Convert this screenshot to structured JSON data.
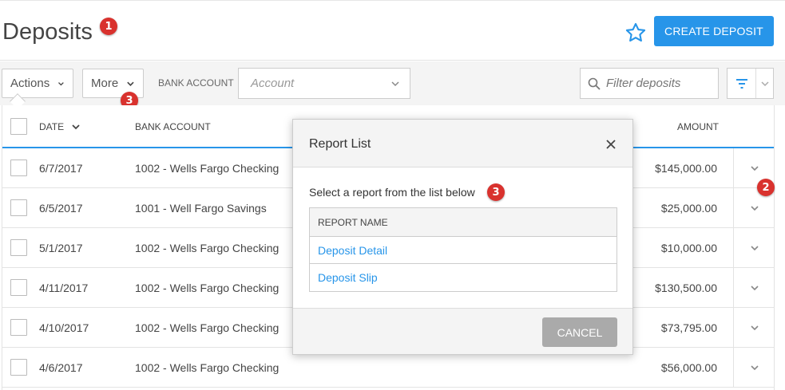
{
  "header": {
    "title": "Deposits",
    "create_label": "CREATE DEPOSIT"
  },
  "badges": {
    "title": "1",
    "row_actions": "2",
    "more": "3",
    "dialog": "3"
  },
  "toolbar": {
    "actions_label": "Actions",
    "more_label": "More",
    "bank_account_label": "BANK ACCOUNT",
    "account_placeholder": "Account",
    "filter_placeholder": "Filter deposits"
  },
  "table": {
    "columns": {
      "date": "DATE",
      "bank_account": "BANK ACCOUNT",
      "amount": "AMOUNT"
    },
    "rows": [
      {
        "date": "6/7/2017",
        "bank": "1002 - Wells Fargo Checking",
        "amount": "$145,000.00"
      },
      {
        "date": "6/5/2017",
        "bank": "1001 - Well Fargo Savings",
        "amount": "$25,000.00"
      },
      {
        "date": "5/1/2017",
        "bank": "1002 - Wells Fargo Checking",
        "amount": "$10,000.00"
      },
      {
        "date": "4/11/2017",
        "bank": "1002 - Wells Fargo Checking",
        "amount": "$130,500.00"
      },
      {
        "date": "4/10/2017",
        "bank": "1002 - Wells Fargo Checking",
        "amount": "$73,795.00"
      },
      {
        "date": "4/6/2017",
        "bank": "1002 - Wells Fargo Checking",
        "amount": "$56,000.00"
      }
    ]
  },
  "modal": {
    "title": "Report List",
    "subtitle": "Select a report from the list below",
    "column": "REPORT NAME",
    "reports": [
      "Deposit Detail",
      "Deposit Slip"
    ],
    "cancel_label": "CANCEL"
  },
  "colors": {
    "accent": "#2795e9",
    "badge": "#d9322e"
  },
  "icons": [
    "star-icon",
    "search-icon",
    "filter-icon",
    "chevron-down-icon",
    "close-icon"
  ]
}
